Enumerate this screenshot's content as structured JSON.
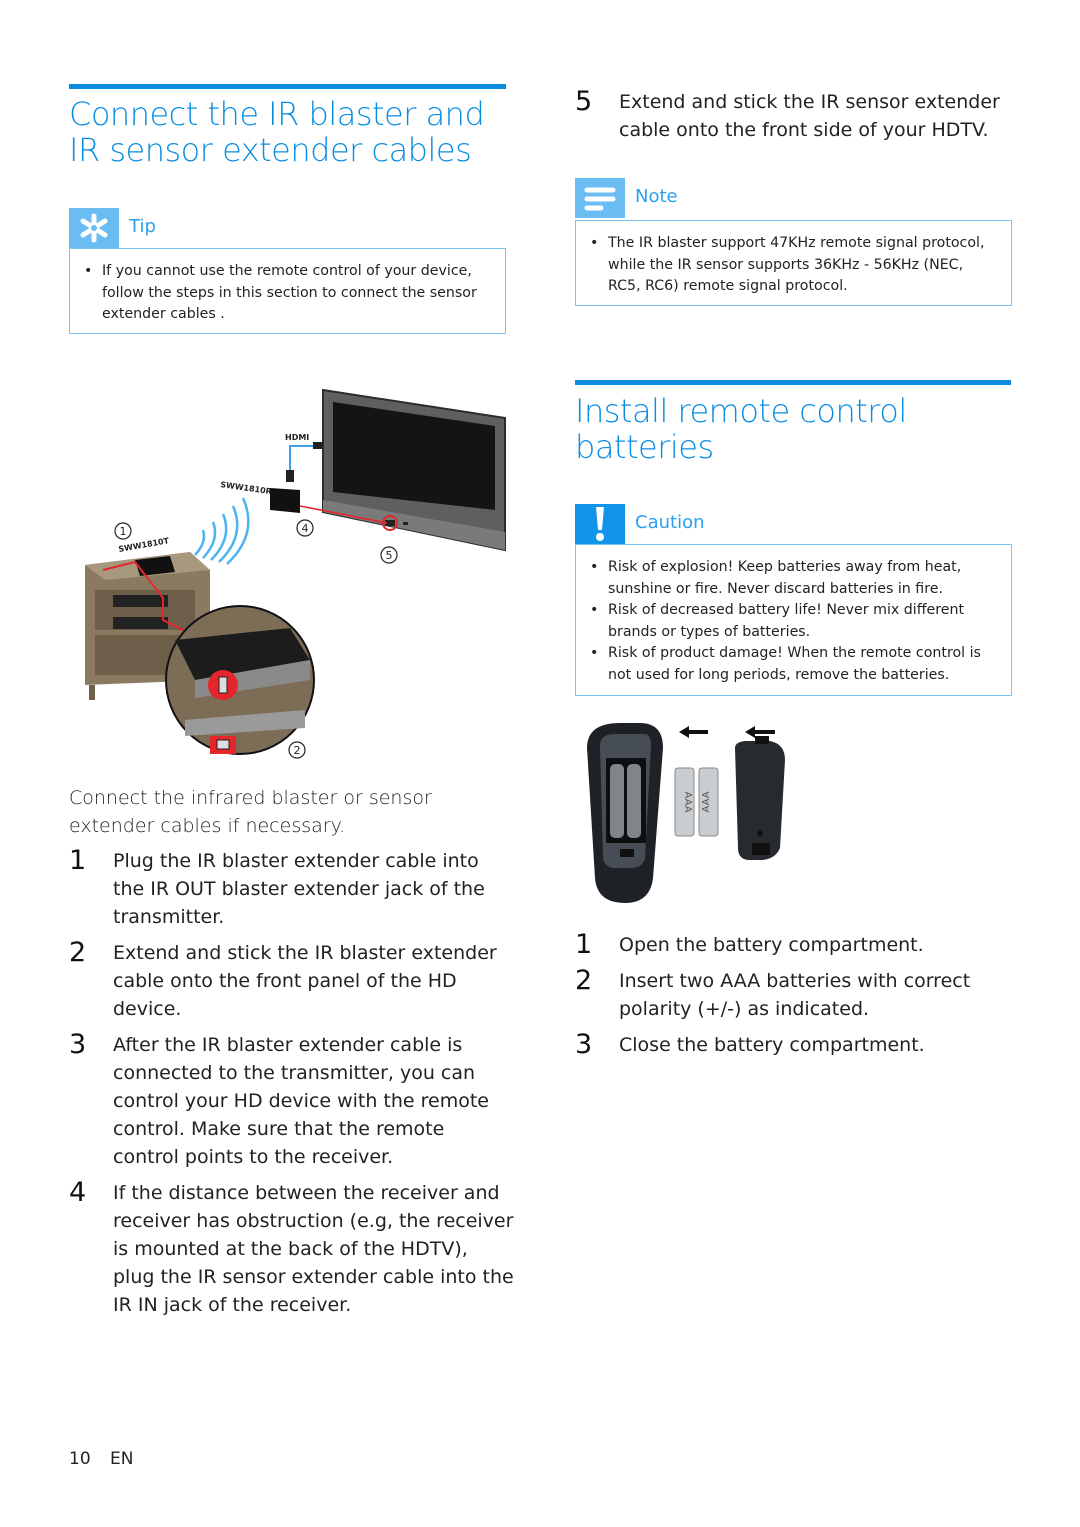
{
  "left_column": {
    "section_title": "Connect the IR blaster and IR sensor extender cables",
    "tip": {
      "icon": "asterisk-icon",
      "label": "Tip",
      "items": [
        "If you cannot use the remote control of your device, follow the steps in this section to connect the sensor extender cables ."
      ]
    },
    "illustration": {
      "labels": {
        "hdmi": "HDMI",
        "receiver": "SWW1810R",
        "transmitter": "SWW1810T",
        "callout_1": "1",
        "callout_2": "2",
        "callout_4": "4",
        "callout_5": "5"
      }
    },
    "intro": "Connect the infrared blaster or sensor extender cables if necessary.",
    "steps": [
      {
        "num": "1",
        "pre": "Plug the IR blaster extender cable into the ",
        "bold": "IR OUT",
        "post": " blaster extender jack of the transmitter."
      },
      {
        "num": "2",
        "text": "Extend and stick the IR blaster extender cable onto the front panel of the HD device."
      },
      {
        "num": "3",
        "text": "After the IR blaster extender cable is connected to the transmitter, you can control your HD device with the remote control. Make sure that the remote control points to the receiver."
      },
      {
        "num": "4",
        "pre": "If the distance between the receiver and receiver has obstruction (e.g, the receiver is mounted at the back of the HDTV), plug the IR sensor extender cable into the ",
        "bold": "IR IN",
        "post": " jack of the receiver."
      }
    ]
  },
  "right_column": {
    "step5": {
      "num": "5",
      "text": "Extend and stick the IR sensor extender cable onto the front side of your HDTV."
    },
    "note": {
      "icon": "note-lines-icon",
      "label": "Note",
      "items": [
        "The IR blaster support 47KHz remote signal protocol, while the IR sensor supports 36KHz - 56KHz (NEC, RC5, RC6) remote signal protocol."
      ]
    },
    "section_title": "Install remote control batteries",
    "caution": {
      "icon": "exclamation-icon",
      "label": "Caution",
      "items": [
        "Risk of explosion! Keep batteries away from heat, sunshine or fire. Never discard batteries in fire.",
        "Risk of decreased battery life! Never mix different brands or types of batteries.",
        "Risk of product damage! When the remote control is not used for long periods, remove the batteries."
      ]
    },
    "illustration": {
      "battery_label": "AAA"
    },
    "steps": [
      {
        "num": "1",
        "text": "Open the battery compartment."
      },
      {
        "num": "2",
        "text": "Insert two AAA batteries with correct polarity (+/-) as indicated."
      },
      {
        "num": "3",
        "text": "Close the battery compartment."
      }
    ]
  },
  "footer": {
    "page_number": "10",
    "language": "EN"
  },
  "colors": {
    "accent": "#0a8de0",
    "icon_light": "#6bbcf2",
    "icon_strong": "#1195ea",
    "border": "#7cc3f3",
    "cable_red": "#e3262b"
  }
}
